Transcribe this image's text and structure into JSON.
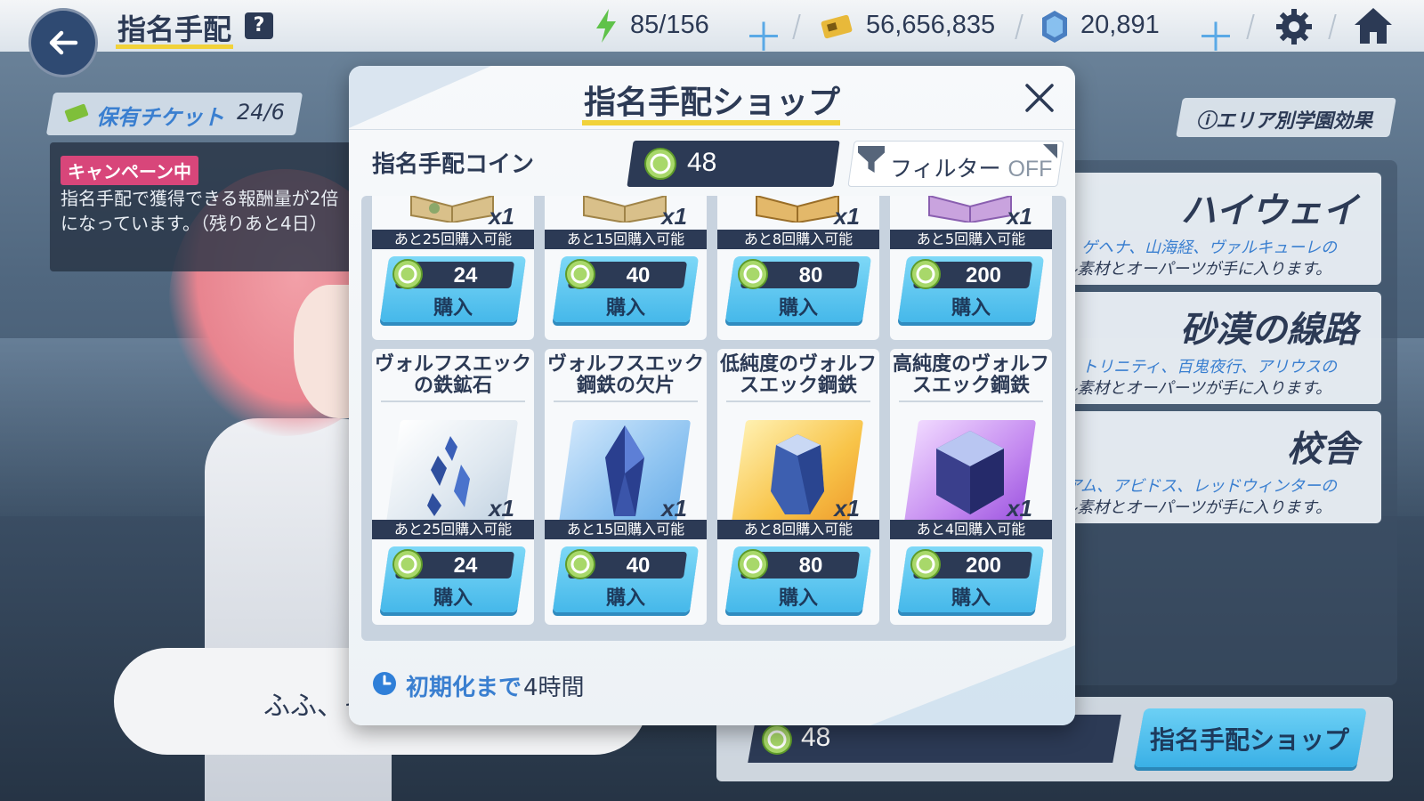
{
  "header": {
    "title": "指名手配",
    "help_icon": "?",
    "stamina": "85/156",
    "credits": "56,656,835",
    "gems": "20,891"
  },
  "ticket": {
    "label": "保有チケット",
    "count": "24/6"
  },
  "campaign": {
    "badge": "キャンペーン中",
    "text": "指名手配で獲得できる報酬量が2倍になっています。（残りあと4日）"
  },
  "area_effect_button": "エリア別学園効果",
  "areas": [
    {
      "name": "ハイウェイ",
      "schools": "ゲヘナ、山海経、ヴァルキューレの",
      "desc": "キル素材とオーパーツが手に入ります。"
    },
    {
      "name": "砂漠の線路",
      "schools": "トリニティ、百鬼夜行、アリウスの",
      "desc": "キル素材とオーパーツが手に入ります。"
    },
    {
      "name": "校舎",
      "schools": "ニアム、アビドス、レッドウィンターの",
      "desc": "キル素材とオーパーツが手に入ります。"
    }
  ],
  "bottom": {
    "coin": "48",
    "shop_button": "指名手配ショップ"
  },
  "speech": "ふふ、そ",
  "modal": {
    "title": "指名手配ショップ",
    "coin_label": "指名手配コイン",
    "coin_value": "48",
    "filter_label": "フィルター",
    "filter_state": "OFF",
    "reset_label": "初期化まで",
    "reset_value": "4時間",
    "row1": [
      {
        "qty": "x1",
        "limit": "あと25回購入可能",
        "price": "24",
        "buy": "購入"
      },
      {
        "qty": "x1",
        "limit": "あと15回購入可能",
        "price": "40",
        "buy": "購入"
      },
      {
        "qty": "x1",
        "limit": "あと8回購入可能",
        "price": "80",
        "buy": "購入"
      },
      {
        "qty": "x1",
        "limit": "あと5回購入可能",
        "price": "200",
        "buy": "購入"
      }
    ],
    "row2": [
      {
        "name": "ヴォルフスエックの鉄鉱石",
        "qty": "x1",
        "limit": "あと25回購入可能",
        "price": "24",
        "buy": "購入"
      },
      {
        "name": "ヴォルフスエック鋼鉄の欠片",
        "qty": "x1",
        "limit": "あと15回購入可能",
        "price": "40",
        "buy": "購入"
      },
      {
        "name": "低純度のヴォルフスエック鋼鉄",
        "qty": "x1",
        "limit": "あと8回購入可能",
        "price": "80",
        "buy": "購入"
      },
      {
        "name": "高純度のヴォルフスエック鋼鉄",
        "qty": "x1",
        "limit": "あと4回購入可能",
        "price": "200",
        "buy": "購入"
      }
    ]
  },
  "colors": {
    "accent_yellow": "#f1d23a",
    "navy": "#2c3a55",
    "buy_button": "#45b8ea",
    "link_blue": "#3a7fd0",
    "campaign_pink": "#d8467a"
  },
  "icons": [
    "back-arrow-icon",
    "help-icon",
    "stamina-bolt-icon",
    "credit-ticket-icon",
    "gem-icon",
    "plus-icon",
    "gear-icon",
    "home-icon",
    "close-icon",
    "coin-icon",
    "filter-icon",
    "clock-icon"
  ]
}
